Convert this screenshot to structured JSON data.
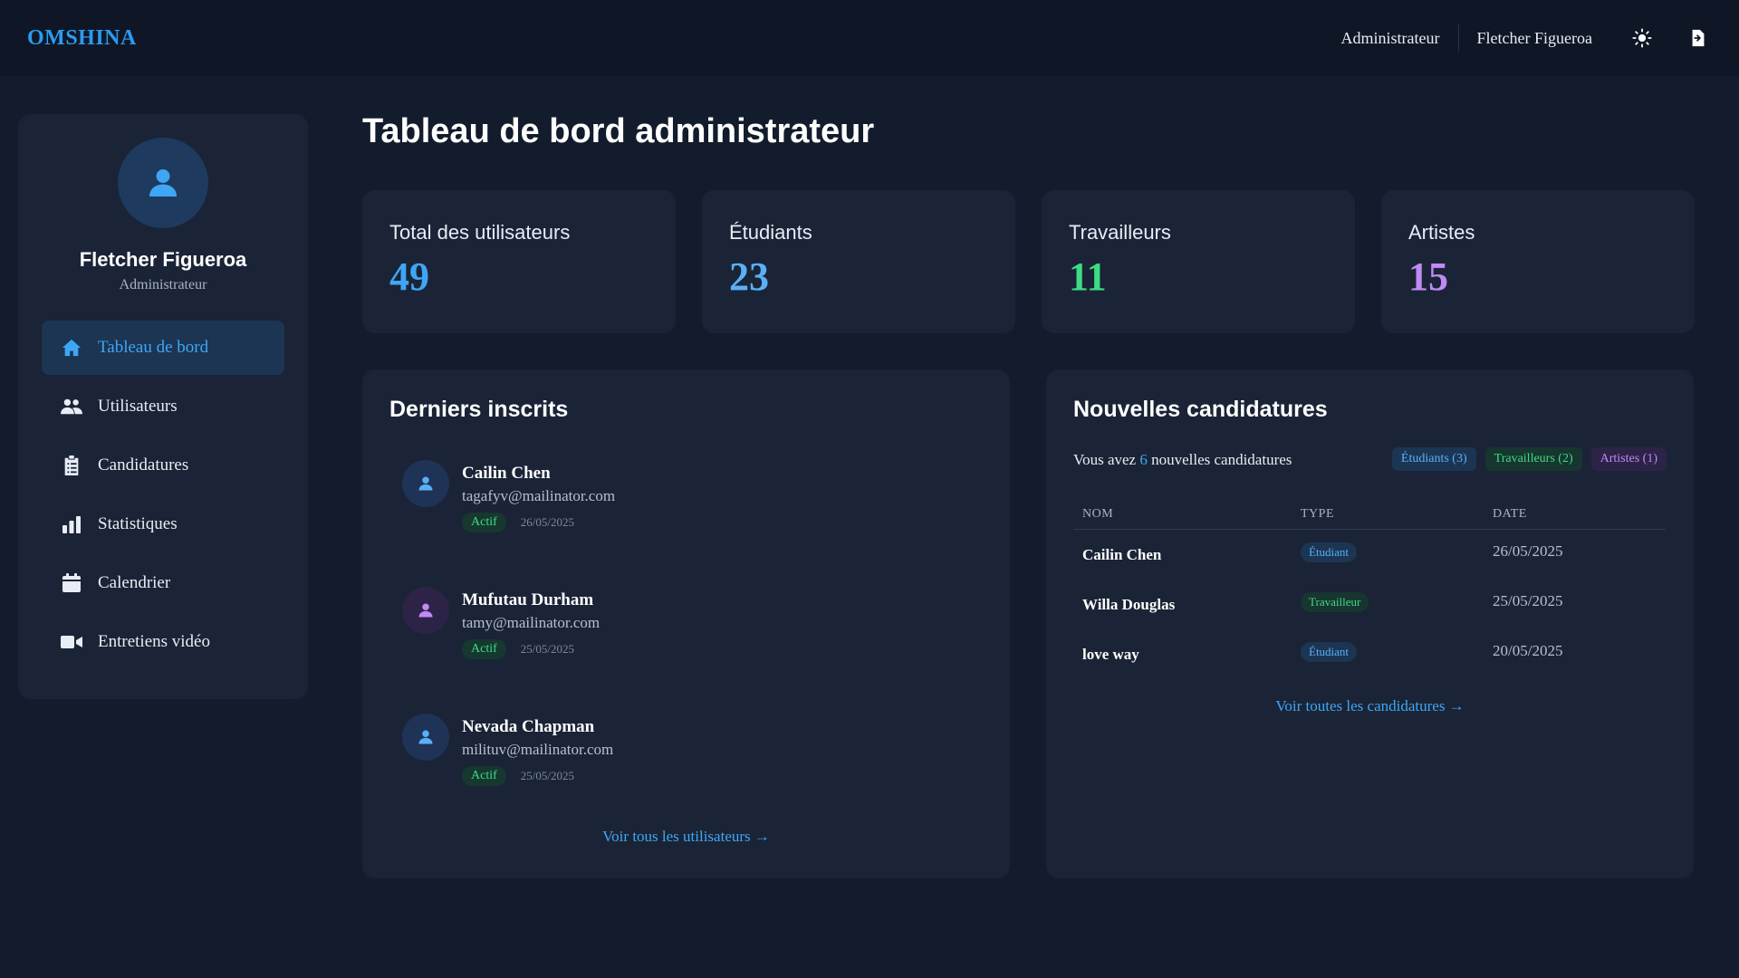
{
  "header": {
    "brand": "OMSHINA",
    "role": "Administrateur",
    "user": "Fletcher Figueroa",
    "icons": [
      "sun-icon",
      "logout-icon"
    ]
  },
  "sidebar": {
    "name": "Fletcher Figueroa",
    "role": "Administrateur",
    "items": [
      {
        "label": "Tableau de bord",
        "icon": "home-icon",
        "active": true
      },
      {
        "label": "Utilisateurs",
        "icon": "users-icon"
      },
      {
        "label": "Candidatures",
        "icon": "clipboard-icon"
      },
      {
        "label": "Statistiques",
        "icon": "bar-chart-icon"
      },
      {
        "label": "Calendrier",
        "icon": "calendar-icon"
      },
      {
        "label": "Entretiens vidéo",
        "icon": "video-icon"
      }
    ]
  },
  "main": {
    "title": "Tableau de bord administrateur",
    "stats": [
      {
        "label": "Total des utilisateurs",
        "value": "49",
        "color": "#3fa6f5"
      },
      {
        "label": "Étudiants",
        "value": "23",
        "color": "#5ab0f7"
      },
      {
        "label": "Travailleurs",
        "value": "11",
        "color": "#3ddc84"
      },
      {
        "label": "Artistes",
        "value": "15",
        "color": "#c08af5"
      }
    ]
  },
  "recent": {
    "title": "Derniers inscrits",
    "users": [
      {
        "name": "Cailin Chen",
        "email": "tagafyv@mailinator.com",
        "status": "Actif",
        "date": "26/05/2025"
      },
      {
        "name": "Mufutau Durham",
        "email": "tamy@mailinator.com",
        "status": "Actif",
        "date": "25/05/2025"
      },
      {
        "name": "Nevada Chapman",
        "email": "milituv@mailinator.com",
        "status": "Actif",
        "date": "25/05/2025"
      }
    ],
    "link": "Voir tous les utilisateurs →"
  },
  "applications": {
    "title": "Nouvelles candidatures",
    "sub_prefix": "Vous avez",
    "count": "6",
    "sub_suffix": "nouvelles candidatures",
    "chips": [
      "Étudiants (3)",
      "Travailleurs (2)",
      "Artistes (1)"
    ],
    "columns": [
      "NOM",
      "TYPE",
      "DATE"
    ],
    "rows": [
      {
        "name": "Cailin Chen",
        "type": "Étudiant",
        "date": "26/05/2025"
      },
      {
        "name": "Willa Douglas",
        "type": "Travailleur",
        "date": "25/05/2025"
      },
      {
        "name": "love way",
        "type": "Étudiant",
        "date": "20/05/2025"
      }
    ],
    "link": "Voir toutes les candidatures →"
  }
}
